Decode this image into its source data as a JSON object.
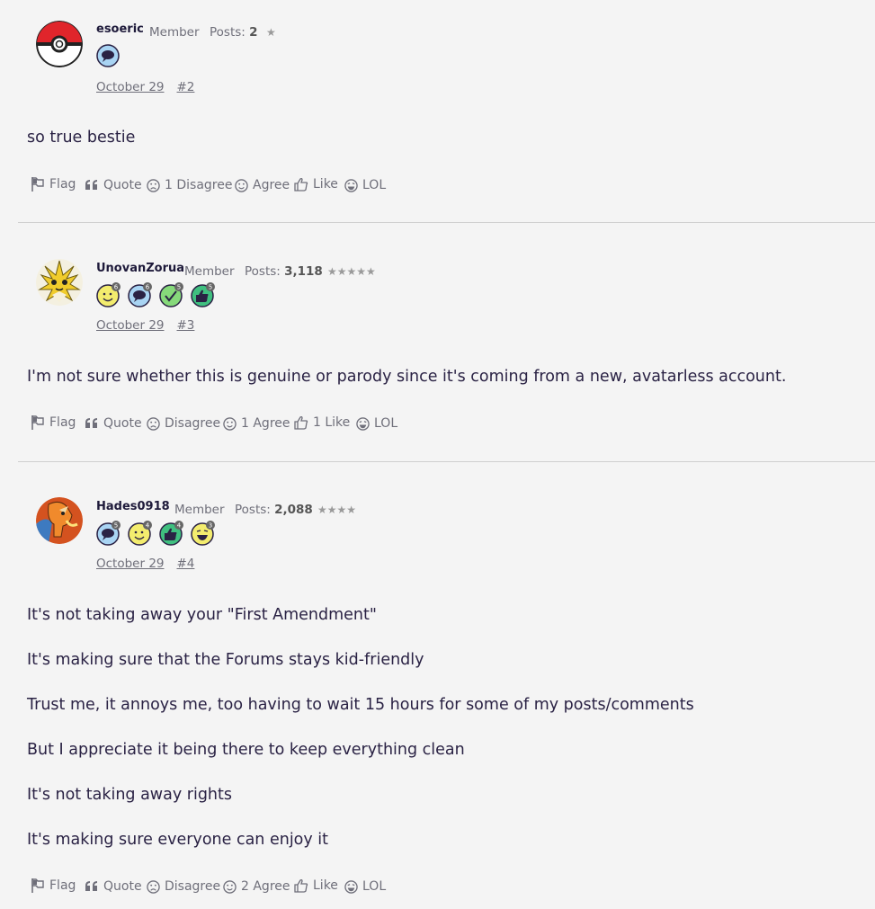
{
  "posts": [
    {
      "username": "esoeric",
      "role": "Member",
      "posts_label": "Posts:",
      "posts_count": "2",
      "stars": "★",
      "date": "October 29",
      "number": "#2",
      "lines": [
        "so true bestie"
      ],
      "actions": {
        "flag": "Flag",
        "quote": "Quote",
        "disagree": "1 Disagree",
        "agree": "Agree",
        "like": "Like",
        "lol": "LOL"
      }
    },
    {
      "username": "UnovanZorua",
      "role": "Member",
      "posts_label": "Posts:",
      "posts_count": "3,118",
      "stars": "★★★★★",
      "date": "October 29",
      "number": "#3",
      "lines": [
        "I'm not sure whether this is genuine or parody since it's coming from a new, avatarless account."
      ],
      "actions": {
        "flag": "Flag",
        "quote": "Quote",
        "disagree": "Disagree",
        "agree": "1 Agree",
        "like": "1 Like",
        "lol": "LOL"
      }
    },
    {
      "username": "Hades0918",
      "role": "Member",
      "posts_label": "Posts:",
      "posts_count": "2,088",
      "stars": "★★★★",
      "date": "October 29",
      "number": "#4",
      "lines": [
        "It's not taking away your \"First Amendment\"",
        "It's making sure that the Forums stays kid-friendly",
        "Trust me, it annoys me, too having to wait 15 hours for some of my posts/comments",
        "But I appreciate it being there to keep everything clean",
        "It's not taking away rights",
        "It's making sure everyone can enjoy it"
      ],
      "actions": {
        "flag": "Flag",
        "quote": "Quote",
        "disagree": "Disagree",
        "agree": "2 Agree",
        "like": "Like",
        "lol": "LOL"
      }
    }
  ],
  "badge_counts": {
    "p2": [
      "6",
      "6",
      "5",
      "5"
    ],
    "p3": [
      "5",
      "4",
      "4",
      "3"
    ]
  },
  "colors": {
    "text": "#2a2244",
    "muted": "#6f6f7a",
    "background": "#f4f4f4",
    "divider": "#cfcfcf"
  }
}
